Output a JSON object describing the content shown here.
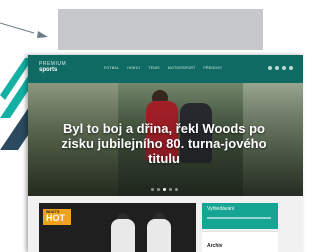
{
  "site": {
    "logo_top": "PREMIUM",
    "logo_main": "sports"
  },
  "nav": {
    "items": [
      {
        "label": "FOTBAL"
      },
      {
        "label": "HOKEJ"
      },
      {
        "label": "TENIS"
      },
      {
        "label": "MOTORSPORT"
      },
      {
        "label": "PŘENOSY"
      }
    ]
  },
  "hero": {
    "title": "Byl to boj a dřina, řekl Woods po zisku jubilejního 80. turna-jového titulu",
    "slides": 5,
    "active_slide": 3
  },
  "hot": {
    "badge_small": "WHAT'S",
    "badge_big": "HOT"
  },
  "sidebar": {
    "green_card_title": "Vyhledávání",
    "archive_title": "Archiv"
  },
  "colors": {
    "accent_teal": "#0e6a63",
    "sidebar_green": "#16a592",
    "hot_orange": "#f0a21a",
    "callout_gray": "#c6c8cb"
  }
}
